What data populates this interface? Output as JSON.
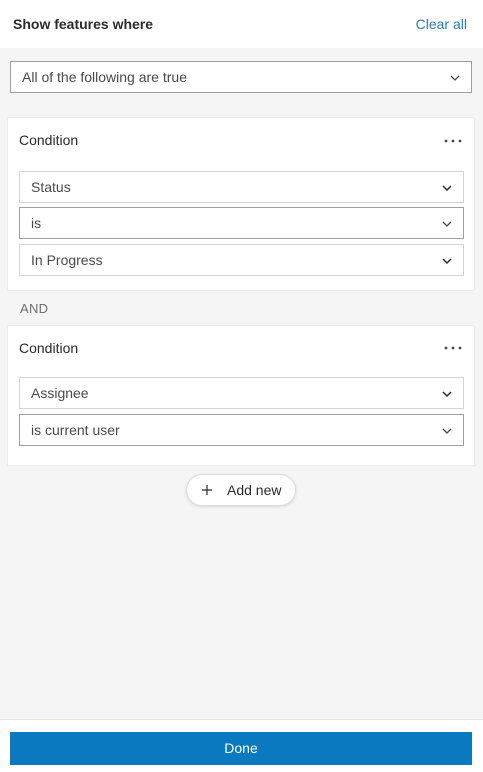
{
  "header": {
    "title": "Show features where",
    "clear_label": "Clear all"
  },
  "match_select": {
    "value": "All of the following are true"
  },
  "conditions": [
    {
      "title": "Condition",
      "field": "Status",
      "operator": "is",
      "value": "In Progress"
    },
    {
      "title": "Condition",
      "field": "Assignee",
      "operator": "is current user"
    }
  ],
  "logic_operator": "AND",
  "add_new_label": "Add new",
  "footer": {
    "done_label": "Done"
  },
  "colors": {
    "accent": "#0a79bf",
    "link": "#2b7fb8"
  },
  "icons": {
    "chevron": "chevron-down-icon",
    "more": "more-horizontal-icon",
    "plus": "plus-icon"
  }
}
